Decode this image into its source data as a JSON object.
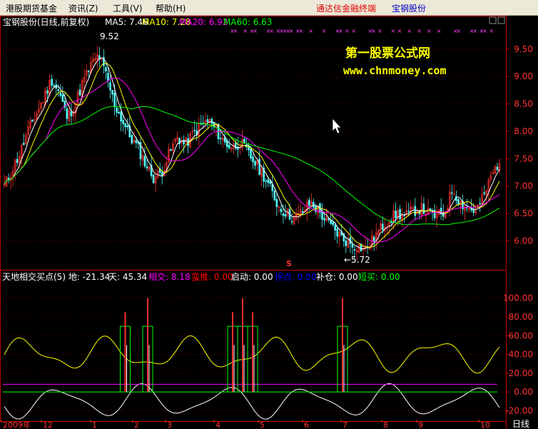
{
  "menubar": {
    "items": [
      "港股期货基金",
      "资讯(Z)",
      "工具(V)",
      "帮助(H)"
    ],
    "brand_text": "通达信金融终端",
    "stock_link": "宝钢股份"
  },
  "price_panel": {
    "title": "宝钢股份(日线,前复权)",
    "ma_labels": [
      {
        "text": "MA5: 7.46",
        "color": "#ffffff"
      },
      {
        "text": "MA10: 7.28",
        "color": "#ffff00"
      },
      {
        "text": "MA20: 6.92",
        "color": "#ff00ff"
      },
      {
        "text": "MA60: 6.63",
        "color": "#00ff00"
      }
    ],
    "watermark_line1": "第一股票公式网",
    "watermark_line2": "www.chnmoney.com",
    "high_marker": "9.52",
    "low_marker": "←5.72",
    "s_marker": "S"
  },
  "indicator_panel": {
    "labels": [
      {
        "text": "天地相交买点(5) 地: -21.34",
        "color": "#ffffff"
      },
      {
        "text": "天: 45.34",
        "color": "#ffffff"
      },
      {
        "text": "相交: 8.18",
        "color": "#ff00ff"
      },
      {
        "text": "蛮推: 0.00",
        "color": "#ff0000"
      },
      {
        "text": "启动: 0.00",
        "color": "#ffffff"
      },
      {
        "text": "拐点: 0.00",
        "color": "#0000ff"
      },
      {
        "text": "补仓: 0.00",
        "color": "#ffffff"
      },
      {
        "text": "短买: 0.00",
        "color": "#00ff00"
      }
    ]
  },
  "x_axis": {
    "labels": [
      "2009年",
      "12",
      "1",
      "2",
      "3",
      "4",
      "5",
      "6",
      "7",
      "8",
      "9",
      "10"
    ],
    "period": "日线"
  },
  "chart_data": {
    "type": "candlestick",
    "price_axis": {
      "ticks": [
        "9.50",
        "9.00",
        "8.50",
        "8.00",
        "7.50",
        "7.00",
        "6.50",
        "6.00"
      ],
      "ylim": [
        5.55,
        9.85
      ]
    },
    "indicator_axis": {
      "ticks": [
        "100.00",
        "80.00",
        "60.00",
        "40.00",
        "20.00",
        "0.00",
        "-20.00"
      ],
      "ylim": [
        -25,
        115
      ]
    },
    "close_anchors": [
      7.0,
      7.3,
      7.6,
      8.0,
      8.3,
      8.6,
      8.95,
      8.7,
      8.25,
      8.5,
      8.9,
      9.2,
      9.4,
      9.0,
      8.5,
      8.2,
      7.9,
      7.7,
      7.4,
      7.15,
      7.25,
      7.6,
      7.9,
      7.75,
      7.95,
      8.1,
      8.2,
      8.0,
      7.8,
      7.7,
      7.8,
      7.6,
      7.4,
      7.2,
      6.9,
      6.6,
      6.5,
      6.4,
      6.55,
      6.7,
      6.55,
      6.35,
      6.2,
      6.05,
      5.95,
      5.9,
      5.85,
      6.05,
      6.25,
      6.4,
      6.5,
      6.45,
      6.55,
      6.6,
      6.5,
      6.45,
      6.5,
      6.95,
      6.7,
      6.6,
      6.55,
      6.8,
      7.2,
      7.46
    ],
    "ma_latest": {
      "MA5": 7.46,
      "MA10": 7.28,
      "MA20": 6.92,
      "MA60": 6.63
    },
    "high": 9.52,
    "low": 5.72,
    "indicator_series": [
      {
        "name": "天",
        "color": "#ffff00",
        "latest": 45.34
      },
      {
        "name": "地",
        "color": "#ffffff",
        "latest": -21.34
      },
      {
        "name": "相交",
        "color": "#ff00ff",
        "latest": 8.18
      }
    ],
    "signal_x_fraction": [
      0.245,
      0.29,
      0.46,
      0.48,
      0.5,
      0.68
    ],
    "colors": {
      "up": "#ff3232",
      "down": "#54fcfc",
      "grid": "#800000",
      "axis": "#c00000"
    }
  }
}
